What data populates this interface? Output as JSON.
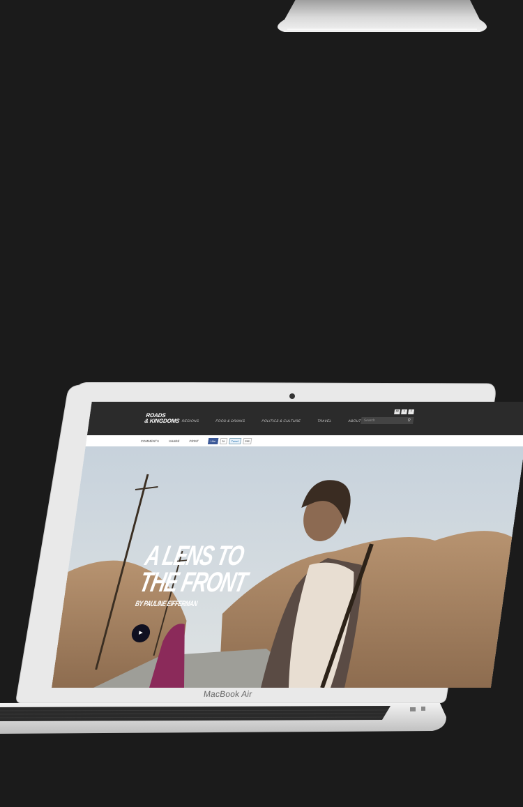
{
  "site": {
    "logo_line1": "ROADS",
    "logo_line2": "& KINGDOMS",
    "nav": [
      "REGIONS",
      "FOOD & DRINKS",
      "POLITICS & CULTURE",
      "TRAVEL",
      "ABOUT"
    ],
    "search_placeholder": "Search",
    "share": [
      "COMMENTS",
      "SHARE",
      "PRINT"
    ],
    "fb_label": "Like",
    "fb_count": "1k",
    "tw_label": "Tweet",
    "g_label": "296"
  },
  "hero": {
    "headline_line1": "A LENS TO",
    "headline_line2": "THE FRONT",
    "byline": "BY PAULINE EIFFERMAN"
  },
  "device": {
    "brand": "MacBook Air"
  },
  "icons": [
    "search-icon",
    "mail-icon",
    "twitter-icon",
    "facebook-icon",
    "play-icon"
  ]
}
